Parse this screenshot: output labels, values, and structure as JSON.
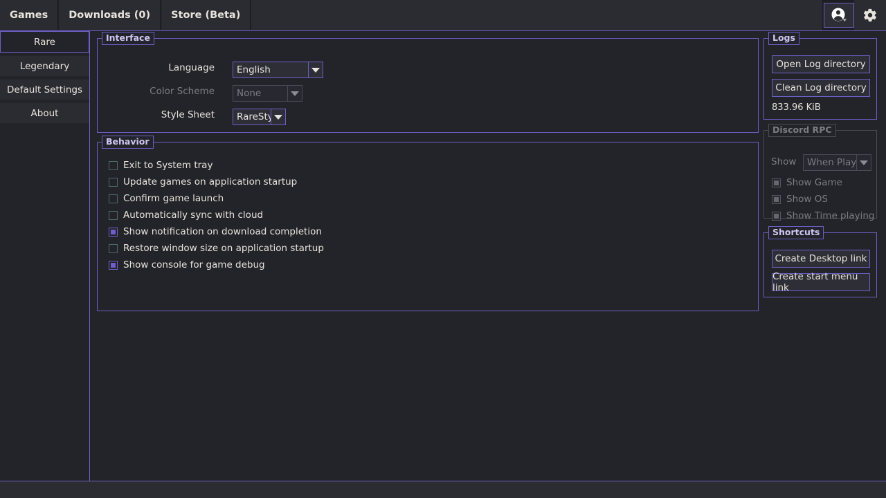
{
  "tabs": [
    {
      "label": "Games",
      "name": "tab-games"
    },
    {
      "label": "Downloads (0)",
      "name": "tab-downloads"
    },
    {
      "label": "Store (Beta)",
      "name": "tab-store"
    }
  ],
  "topbar": {
    "account_icon": "account-circle-icon",
    "settings_icon": "gear-icon"
  },
  "sidebar": {
    "items": [
      {
        "label": "Rare",
        "selected": true
      },
      {
        "label": "Legendary",
        "selected": false
      },
      {
        "label": "Default Settings",
        "selected": false
      },
      {
        "label": "About",
        "selected": false
      }
    ]
  },
  "interface": {
    "title": "Interface",
    "language": {
      "label": "Language",
      "value": "English"
    },
    "color_scheme": {
      "label": "Color Scheme",
      "value": "None",
      "disabled": true
    },
    "style_sheet": {
      "label": "Style Sheet",
      "value": "RareStyle"
    }
  },
  "behavior": {
    "title": "Behavior",
    "options": [
      {
        "label": "Exit to System tray",
        "checked": false
      },
      {
        "label": "Update games on application startup",
        "checked": false
      },
      {
        "label": "Confirm game launch",
        "checked": false
      },
      {
        "label": "Automatically sync with cloud",
        "checked": false
      },
      {
        "label": "Show notification on download completion",
        "checked": true
      },
      {
        "label": "Restore window size on application startup",
        "checked": false
      },
      {
        "label": "Show console for game debug",
        "checked": true
      }
    ]
  },
  "logs": {
    "title": "Logs",
    "open_button": "Open Log directory",
    "clean_button": "Clean Log directory",
    "size": "833.96 KiB"
  },
  "discord_rpc": {
    "title": "Discord RPC",
    "disabled": true,
    "show_label": "Show",
    "show_value": "When Playing",
    "options": [
      {
        "label": "Show Game",
        "checked": true
      },
      {
        "label": "Show OS",
        "checked": true
      },
      {
        "label": "Show Time playing",
        "checked": true
      }
    ]
  },
  "shortcuts": {
    "title": "Shortcuts",
    "desktop_button": "Create Desktop link",
    "start_menu_button": "Create start menu link"
  },
  "colors": {
    "accent": "#6c5fc7",
    "background": "#232429",
    "panel": "#2b2c31",
    "text": "#e8e3dc",
    "disabled_text": "#7b7c84"
  }
}
